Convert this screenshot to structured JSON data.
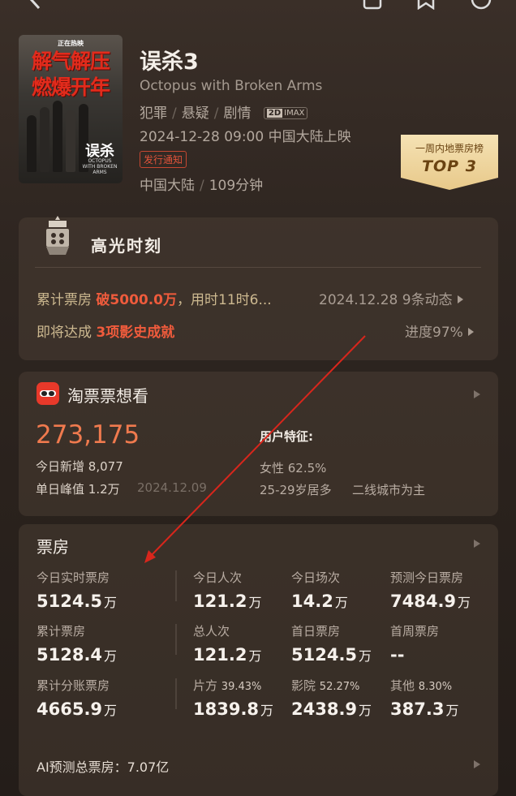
{
  "movie": {
    "title": "误杀3",
    "english_title": "Octopus with Broken Arms",
    "genres": [
      "犯罪",
      "悬疑",
      "剧情"
    ],
    "format_badge_2d": "2D",
    "format_badge_imax": "IMAX",
    "release": "2024-12-28 09:00 中国大陆上映",
    "notice_tag": "发行通知",
    "region": "中国大陆",
    "duration": "109分钟"
  },
  "poster": {
    "tagline": "正在热映",
    "line1": "解气解压",
    "line2": "燃爆开年",
    "logo": "误杀",
    "sub": "OCTOPUS WITH BROKEN ARMS"
  },
  "rank_badge": {
    "line1": "一周内地票房榜",
    "line2": "TOP 3"
  },
  "highlights": {
    "title": "高光时刻",
    "row1_prefix": "累计票房 ",
    "row1_red": "破5000.0万",
    "row1_suffix": "，用时11时6...",
    "row1_date": "2024.12.28",
    "row1_updates": "9条动态",
    "row2_prefix": "即将达成 ",
    "row2_red": "3项影史成就",
    "row2_progress": "进度97%"
  },
  "taopiao": {
    "title": "淘票票想看",
    "count": "273,175",
    "today_label": "今日新增",
    "today_value": "8,077",
    "peak_label": "单日峰值",
    "peak_value": "1.2万",
    "peak_date": "2024.12.09",
    "features_title": "用户特征:",
    "gender": "女性 62.5%",
    "age": "25-29岁居多",
    "city": "二线城市为主"
  },
  "box_office": {
    "title": "票房",
    "unit": "万",
    "rows": [
      [
        {
          "label": "今日实时票房",
          "value": "5124.5",
          "pct": ""
        },
        {
          "label": "今日人次",
          "value": "121.2",
          "pct": ""
        },
        {
          "label": "今日场次",
          "value": "14.2",
          "pct": ""
        },
        {
          "label": "预测今日票房",
          "value": "7484.9",
          "pct": ""
        }
      ],
      [
        {
          "label": "累计票房",
          "value": "5128.4",
          "pct": ""
        },
        {
          "label": "总人次",
          "value": "121.2",
          "pct": ""
        },
        {
          "label": "首日票房",
          "value": "5124.5",
          "pct": ""
        },
        {
          "label": "首周票房",
          "value": "--",
          "pct": ""
        }
      ],
      [
        {
          "label": "累计分账票房",
          "value": "4665.9",
          "pct": ""
        },
        {
          "label": "片方",
          "value": "1839.8",
          "pct": "39.43%"
        },
        {
          "label": "影院",
          "value": "2438.9",
          "pct": "52.27%"
        },
        {
          "label": "其他",
          "value": "387.3",
          "pct": "8.30%"
        }
      ]
    ],
    "ai_prediction": "AI预测总票房：7.07亿"
  },
  "colors": {
    "accent_red": "#ef5b3c",
    "count_orange": "#f07a4e",
    "gold": "#e8c98a",
    "annotation_red": "#d8261c"
  }
}
